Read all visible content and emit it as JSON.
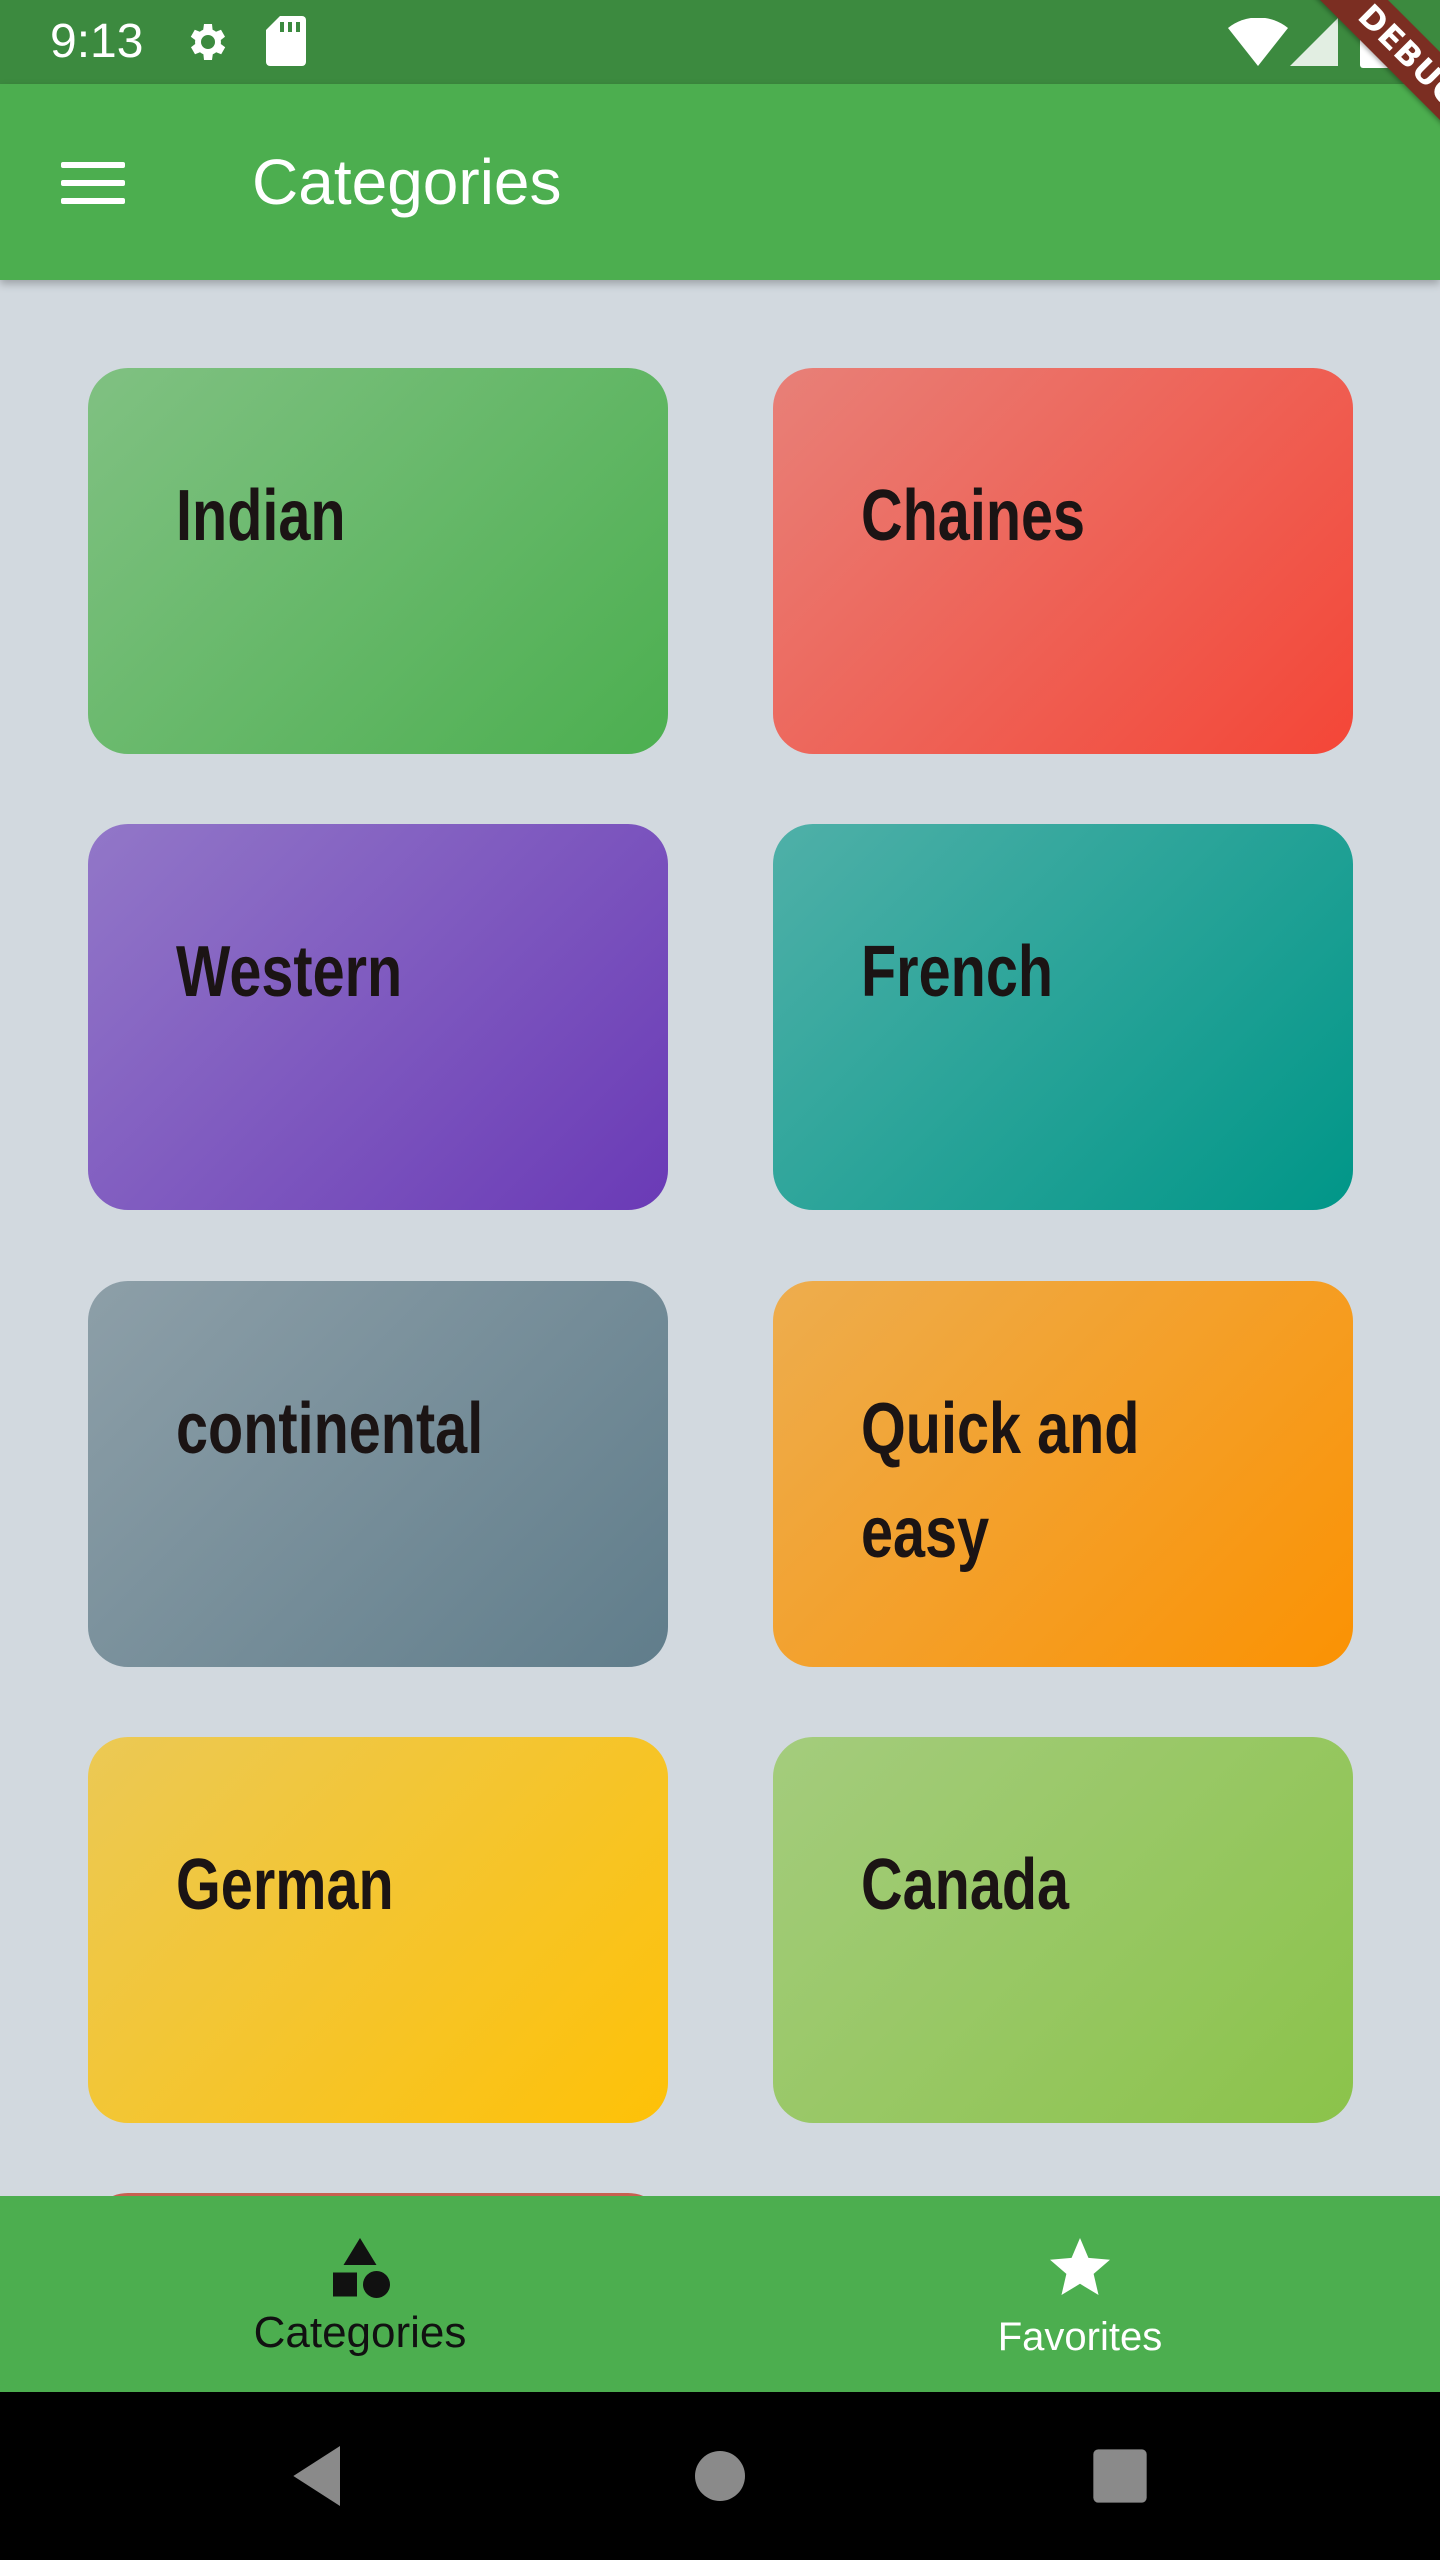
{
  "status_bar": {
    "time": "9:13",
    "icons": [
      "gear-icon",
      "sd-card-icon",
      "wifi-icon",
      "signal-icon",
      "battery-icon"
    ]
  },
  "debug_banner": {
    "label": "DEBUG"
  },
  "app_bar": {
    "title": "Categories",
    "menu_icon": "hamburger-menu-icon"
  },
  "categories": [
    {
      "label": "Indian",
      "colors": [
        "#80c182",
        "#4caf50"
      ]
    },
    {
      "label": "Chaines",
      "colors": [
        "#e88078",
        "#f44637"
      ]
    },
    {
      "label": "Western",
      "colors": [
        "#9277c8",
        "#6a3ab6"
      ]
    },
    {
      "label": "French",
      "colors": [
        "#4fb0a8",
        "#009688"
      ]
    },
    {
      "label": "continental",
      "colors": [
        "#8d9fa8",
        "#607d8b"
      ]
    },
    {
      "label": "Quick and easy",
      "colors": [
        "#edad4e",
        "#fb9203"
      ]
    },
    {
      "label": "German",
      "colors": [
        "#ebc955",
        "#fec107"
      ]
    },
    {
      "label": "Canada",
      "colors": [
        "#a4cc7d",
        "#8bc34a"
      ]
    }
  ],
  "bottom_nav": {
    "items": [
      {
        "label": "Categories",
        "icon": "shapes-icon",
        "selected": true
      },
      {
        "label": "Favorites",
        "icon": "star-icon",
        "selected": false
      }
    ]
  },
  "system_nav": {
    "icons": [
      "back-icon",
      "home-icon",
      "recents-icon"
    ]
  },
  "colors": {
    "app_bar": "#4cae4f",
    "status_bar": "#3c8a3f",
    "background": "#d2d9df"
  }
}
